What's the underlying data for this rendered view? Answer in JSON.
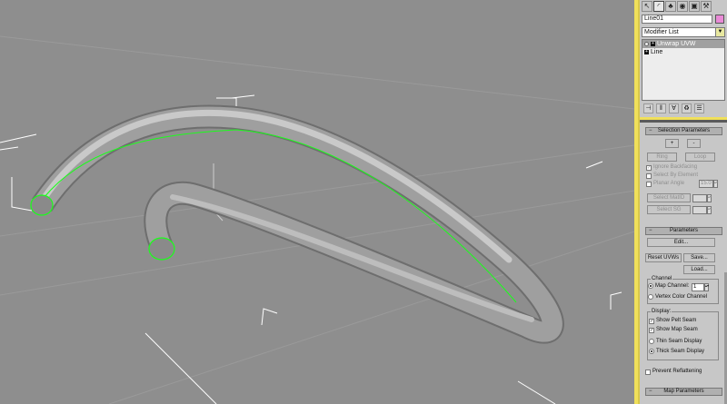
{
  "viewport": {
    "background": "#8e8e8e",
    "object_color": "#9f9f9f",
    "seam_color": "#1aff1a"
  },
  "panel": {
    "tabs": [
      {
        "icon": "create-icon",
        "glyph": "↖"
      },
      {
        "icon": "modify-icon",
        "glyph": "◜"
      },
      {
        "icon": "hierarchy-icon",
        "glyph": "♣"
      },
      {
        "icon": "motion-icon",
        "glyph": "◉"
      },
      {
        "icon": "display-icon",
        "glyph": "▣"
      },
      {
        "icon": "utilities-icon",
        "glyph": "⚒"
      }
    ],
    "object_name": "Line01",
    "object_color": "#e98ad6",
    "modifier_list_label": "Modifier List",
    "stack": [
      {
        "label": "Unwrap UVW",
        "selected": true
      },
      {
        "label": "Line",
        "selected": false
      }
    ],
    "selection_parameters": {
      "title": "Selection Parameters",
      "plus": "+",
      "minus": "-",
      "ring": "Ring",
      "loop": "Loop",
      "ignore_backfacing": "Ignore Backfacing",
      "select_by_element": "Select By Element",
      "planar_angle": "Planar Angle",
      "planar_angle_value": "15.0",
      "select_matid": "Select MatID",
      "select_sg": "Select SG"
    },
    "parameters": {
      "title": "Parameters",
      "edit": "Edit...",
      "reset_uvws": "Reset UVWs",
      "save": "Save...",
      "load": "Load...",
      "channel_title": "Channel",
      "map_channel": "Map Channel:",
      "map_channel_value": "1",
      "vertex_color_channel": "Vertex Color Channel",
      "display_title": "Display:",
      "show_pelt_seam": "Show Pelt Seam",
      "show_map_seam": "Show Map Seam",
      "thin_seam_display": "Thin Seam Display",
      "thick_seam_display": "Thick Seam Display",
      "prevent_reflattening": "Prevent Reflattening"
    },
    "map_parameters_title": "Map Parameters"
  }
}
